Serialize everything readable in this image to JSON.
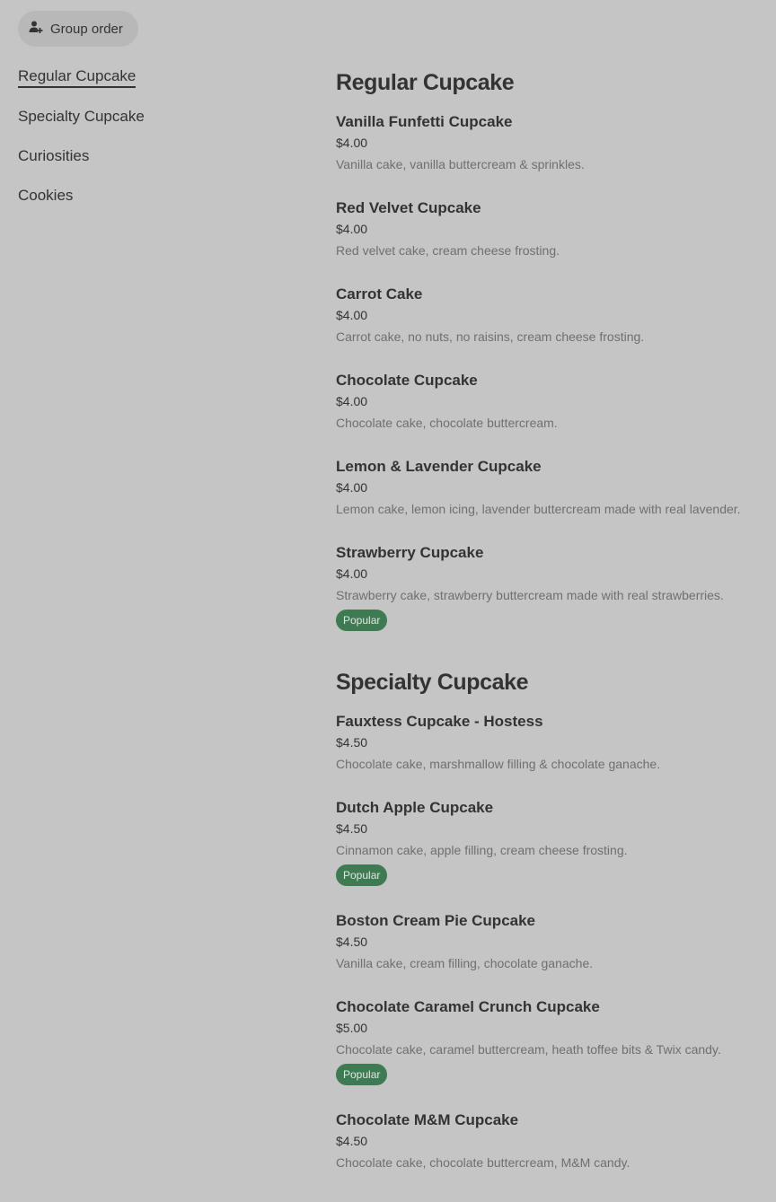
{
  "group_order": {
    "label": "Group order",
    "icon": "add-person-icon"
  },
  "sidebar": {
    "items": [
      {
        "label": "Regular Cupcake",
        "active": true
      },
      {
        "label": "Specialty Cupcake"
      },
      {
        "label": "Curiosities"
      },
      {
        "label": "Cookies"
      }
    ]
  },
  "sections": [
    {
      "title": "Regular Cupcake",
      "items": [
        {
          "name": "Vanilla Funfetti Cupcake",
          "price": "$4.00",
          "desc": "Vanilla cake, vanilla buttercream & sprinkles."
        },
        {
          "name": "Red Velvet Cupcake",
          "price": "$4.00",
          "desc": "Red velvet cake, cream cheese frosting."
        },
        {
          "name": "Carrot Cake",
          "price": "$4.00",
          "desc": "Carrot cake, no nuts, no raisins, cream cheese frosting."
        },
        {
          "name": "Chocolate Cupcake",
          "price": "$4.00",
          "desc": "Chocolate cake, chocolate buttercream."
        },
        {
          "name": "Lemon & Lavender Cupcake",
          "price": "$4.00",
          "desc": "Lemon cake, lemon icing, lavender buttercream made with real lavender."
        },
        {
          "name": "Strawberry Cupcake",
          "price": "$4.00",
          "desc": "Strawberry cake, strawberry buttercream made with real strawberries.",
          "badge": "Popular"
        }
      ]
    },
    {
      "title": "Specialty Cupcake",
      "items": [
        {
          "name": "Fauxtess Cupcake - Hostess",
          "price": "$4.50",
          "desc": "Chocolate cake, marshmallow filling & chocolate ganache."
        },
        {
          "name": "Dutch Apple Cupcake",
          "price": "$4.50",
          "desc": "Cinnamon cake, apple filling, cream cheese frosting.",
          "badge": "Popular"
        },
        {
          "name": "Boston Cream Pie Cupcake",
          "price": "$4.50",
          "desc": "Vanilla cake, cream filling, chocolate ganache."
        },
        {
          "name": "Chocolate Caramel Crunch Cupcake",
          "price": "$5.00",
          "desc": "Chocolate cake, caramel buttercream, heath toffee bits & Twix candy.",
          "badge": "Popular"
        },
        {
          "name": "Chocolate M&M Cupcake",
          "price": "$4.50",
          "desc": "Chocolate cake, chocolate buttercream, M&M candy."
        }
      ]
    }
  ],
  "colors": {
    "background": "#c5c5c5",
    "badge": "#3e7a52"
  }
}
